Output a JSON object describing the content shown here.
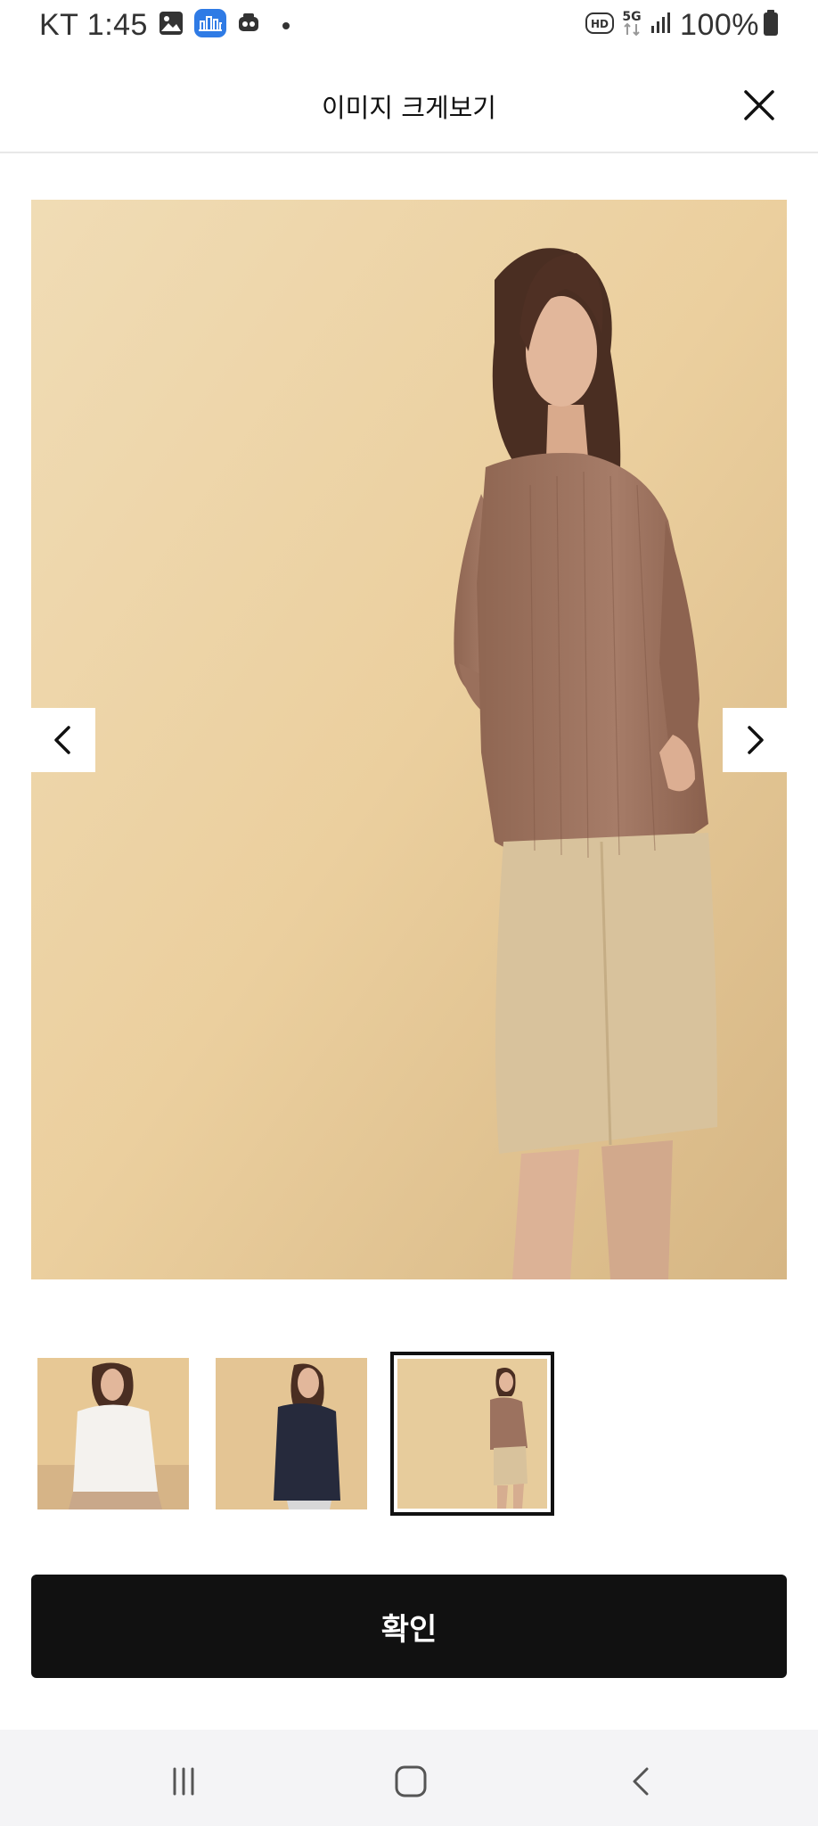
{
  "status_bar": {
    "carrier_time": "KT 1:45",
    "icons": [
      "gallery-icon",
      "building-app-icon",
      "tray-icon",
      "dot-icon",
      "hd-icon",
      "5g-icon",
      "signal-icon",
      "battery-icon"
    ],
    "battery": "100%"
  },
  "header": {
    "title": "이미지 크게보기",
    "close_icon": "close-icon"
  },
  "gallery": {
    "prev_icon": "chevron-left-icon",
    "next_icon": "chevron-right-icon",
    "thumbnails": [
      {
        "name": "thumbnail-1",
        "selected": false
      },
      {
        "name": "thumbnail-2",
        "selected": false
      },
      {
        "name": "thumbnail-3",
        "selected": true
      }
    ]
  },
  "confirm_label": "확인",
  "nav_bar": {
    "items": [
      "recent-apps-icon",
      "home-icon",
      "back-icon"
    ]
  },
  "colors": {
    "accent": "#111111",
    "backdrop": "#e9cf9f",
    "blouse": "#9c725f",
    "skirt": "#d8c29c"
  }
}
